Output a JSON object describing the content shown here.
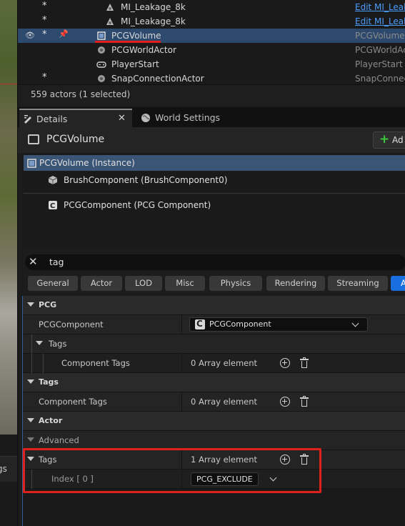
{
  "outliner": {
    "rows": [
      {
        "name": "MI_Leakage_8k",
        "type": "Edit MI_Leak"
      },
      {
        "name": "MI_Leakage_8k",
        "type": "Edit MI_Leak"
      },
      {
        "name": "PCGVolume",
        "type": "PCGVolume"
      },
      {
        "name": "PCGWorldActor",
        "type": "PCGWorldAct"
      },
      {
        "name": "PlayerStart",
        "type": "PlayerStart"
      },
      {
        "name": "SnapConnectionActor",
        "type": "SnapConnec"
      }
    ],
    "count": "559 actors (1 selected)"
  },
  "tabs": {
    "details": "Details",
    "world_settings": "World Settings"
  },
  "details": {
    "title": "PCGVolume",
    "add_label": "Ad"
  },
  "components": [
    "PCGVolume (Instance)",
    "BrushComponent (BrushComponent0)",
    "PCGComponent (PCG Component)"
  ],
  "search": {
    "value": "tag"
  },
  "chips": [
    "General",
    "Actor",
    "LOD",
    "Misc",
    "Physics",
    "Rendering",
    "Streaming",
    "A"
  ],
  "properties": {
    "pcg_category": "PCG",
    "pcg_component_label": "PCGComponent",
    "pcg_component_value": "PCGComponent",
    "tags_sub": "Tags",
    "component_tags_label": "Component Tags",
    "component_tags_value": "0 Array element",
    "tags_category": "Tags",
    "component_tags2_label": "Component Tags",
    "component_tags2_value": "0 Array element",
    "actor_category": "Actor",
    "advanced_label": "Advanced",
    "actor_tags_label": "Tags",
    "actor_tags_value": "1 Array element",
    "index_label": "Index [ 0 ]",
    "index_value": "PCG_EXCLUDE"
  },
  "viewport": {
    "tab_fragment": "gs"
  }
}
